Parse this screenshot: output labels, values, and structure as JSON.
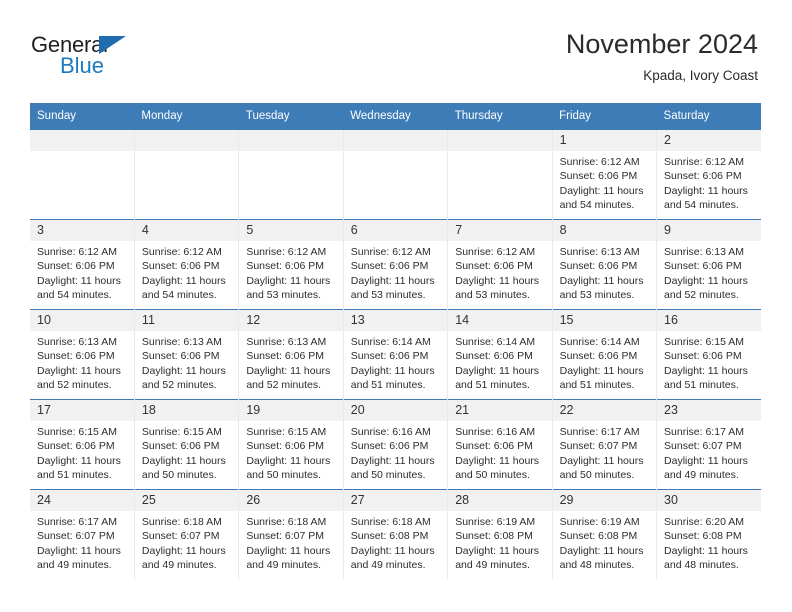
{
  "brand": {
    "name_top": "General",
    "name_bottom": "Blue",
    "triangle_icon": "blue-triangle-icon",
    "accent_color": "#1f7ac0"
  },
  "header": {
    "title": "November 2024",
    "subtitle": "Kpada, Ivory Coast"
  },
  "theme": {
    "header_blue": "#3e7cb8",
    "daynum_gray": "#f1f1f1",
    "text": "#2d2d2d"
  },
  "calendar": {
    "weekday_headers": [
      "Sunday",
      "Monday",
      "Tuesday",
      "Wednesday",
      "Thursday",
      "Friday",
      "Saturday"
    ],
    "labels": {
      "sunrise": "Sunrise:",
      "sunset": "Sunset:",
      "daylight": "Daylight:"
    },
    "weeks": [
      [
        {
          "day": "",
          "empty": true
        },
        {
          "day": "",
          "empty": true
        },
        {
          "day": "",
          "empty": true
        },
        {
          "day": "",
          "empty": true
        },
        {
          "day": "",
          "empty": true
        },
        {
          "day": "1",
          "sunrise": "Sunrise: 6:12 AM",
          "sunset": "Sunset: 6:06 PM",
          "daylight": "Daylight: 11 hours and 54 minutes."
        },
        {
          "day": "2",
          "sunrise": "Sunrise: 6:12 AM",
          "sunset": "Sunset: 6:06 PM",
          "daylight": "Daylight: 11 hours and 54 minutes."
        }
      ],
      [
        {
          "day": "3",
          "sunrise": "Sunrise: 6:12 AM",
          "sunset": "Sunset: 6:06 PM",
          "daylight": "Daylight: 11 hours and 54 minutes."
        },
        {
          "day": "4",
          "sunrise": "Sunrise: 6:12 AM",
          "sunset": "Sunset: 6:06 PM",
          "daylight": "Daylight: 11 hours and 54 minutes."
        },
        {
          "day": "5",
          "sunrise": "Sunrise: 6:12 AM",
          "sunset": "Sunset: 6:06 PM",
          "daylight": "Daylight: 11 hours and 53 minutes."
        },
        {
          "day": "6",
          "sunrise": "Sunrise: 6:12 AM",
          "sunset": "Sunset: 6:06 PM",
          "daylight": "Daylight: 11 hours and 53 minutes."
        },
        {
          "day": "7",
          "sunrise": "Sunrise: 6:12 AM",
          "sunset": "Sunset: 6:06 PM",
          "daylight": "Daylight: 11 hours and 53 minutes."
        },
        {
          "day": "8",
          "sunrise": "Sunrise: 6:13 AM",
          "sunset": "Sunset: 6:06 PM",
          "daylight": "Daylight: 11 hours and 53 minutes."
        },
        {
          "day": "9",
          "sunrise": "Sunrise: 6:13 AM",
          "sunset": "Sunset: 6:06 PM",
          "daylight": "Daylight: 11 hours and 52 minutes."
        }
      ],
      [
        {
          "day": "10",
          "sunrise": "Sunrise: 6:13 AM",
          "sunset": "Sunset: 6:06 PM",
          "daylight": "Daylight: 11 hours and 52 minutes."
        },
        {
          "day": "11",
          "sunrise": "Sunrise: 6:13 AM",
          "sunset": "Sunset: 6:06 PM",
          "daylight": "Daylight: 11 hours and 52 minutes."
        },
        {
          "day": "12",
          "sunrise": "Sunrise: 6:13 AM",
          "sunset": "Sunset: 6:06 PM",
          "daylight": "Daylight: 11 hours and 52 minutes."
        },
        {
          "day": "13",
          "sunrise": "Sunrise: 6:14 AM",
          "sunset": "Sunset: 6:06 PM",
          "daylight": "Daylight: 11 hours and 51 minutes."
        },
        {
          "day": "14",
          "sunrise": "Sunrise: 6:14 AM",
          "sunset": "Sunset: 6:06 PM",
          "daylight": "Daylight: 11 hours and 51 minutes."
        },
        {
          "day": "15",
          "sunrise": "Sunrise: 6:14 AM",
          "sunset": "Sunset: 6:06 PM",
          "daylight": "Daylight: 11 hours and 51 minutes."
        },
        {
          "day": "16",
          "sunrise": "Sunrise: 6:15 AM",
          "sunset": "Sunset: 6:06 PM",
          "daylight": "Daylight: 11 hours and 51 minutes."
        }
      ],
      [
        {
          "day": "17",
          "sunrise": "Sunrise: 6:15 AM",
          "sunset": "Sunset: 6:06 PM",
          "daylight": "Daylight: 11 hours and 51 minutes."
        },
        {
          "day": "18",
          "sunrise": "Sunrise: 6:15 AM",
          "sunset": "Sunset: 6:06 PM",
          "daylight": "Daylight: 11 hours and 50 minutes."
        },
        {
          "day": "19",
          "sunrise": "Sunrise: 6:15 AM",
          "sunset": "Sunset: 6:06 PM",
          "daylight": "Daylight: 11 hours and 50 minutes."
        },
        {
          "day": "20",
          "sunrise": "Sunrise: 6:16 AM",
          "sunset": "Sunset: 6:06 PM",
          "daylight": "Daylight: 11 hours and 50 minutes."
        },
        {
          "day": "21",
          "sunrise": "Sunrise: 6:16 AM",
          "sunset": "Sunset: 6:06 PM",
          "daylight": "Daylight: 11 hours and 50 minutes."
        },
        {
          "day": "22",
          "sunrise": "Sunrise: 6:17 AM",
          "sunset": "Sunset: 6:07 PM",
          "daylight": "Daylight: 11 hours and 50 minutes."
        },
        {
          "day": "23",
          "sunrise": "Sunrise: 6:17 AM",
          "sunset": "Sunset: 6:07 PM",
          "daylight": "Daylight: 11 hours and 49 minutes."
        }
      ],
      [
        {
          "day": "24",
          "sunrise": "Sunrise: 6:17 AM",
          "sunset": "Sunset: 6:07 PM",
          "daylight": "Daylight: 11 hours and 49 minutes."
        },
        {
          "day": "25",
          "sunrise": "Sunrise: 6:18 AM",
          "sunset": "Sunset: 6:07 PM",
          "daylight": "Daylight: 11 hours and 49 minutes."
        },
        {
          "day": "26",
          "sunrise": "Sunrise: 6:18 AM",
          "sunset": "Sunset: 6:07 PM",
          "daylight": "Daylight: 11 hours and 49 minutes."
        },
        {
          "day": "27",
          "sunrise": "Sunrise: 6:18 AM",
          "sunset": "Sunset: 6:08 PM",
          "daylight": "Daylight: 11 hours and 49 minutes."
        },
        {
          "day": "28",
          "sunrise": "Sunrise: 6:19 AM",
          "sunset": "Sunset: 6:08 PM",
          "daylight": "Daylight: 11 hours and 49 minutes."
        },
        {
          "day": "29",
          "sunrise": "Sunrise: 6:19 AM",
          "sunset": "Sunset: 6:08 PM",
          "daylight": "Daylight: 11 hours and 48 minutes."
        },
        {
          "day": "30",
          "sunrise": "Sunrise: 6:20 AM",
          "sunset": "Sunset: 6:08 PM",
          "daylight": "Daylight: 11 hours and 48 minutes."
        }
      ]
    ]
  }
}
